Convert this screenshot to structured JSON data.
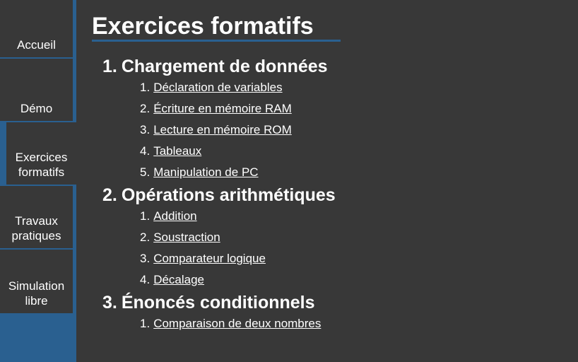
{
  "nav": {
    "items": [
      {
        "label": "Accueil"
      },
      {
        "label": "Démo"
      },
      {
        "label": "Exercices formatifs"
      },
      {
        "label": "Travaux pratiques"
      },
      {
        "label": "Simulation libre"
      }
    ]
  },
  "main": {
    "title": "Exercices formatifs",
    "sections": [
      {
        "number": "1.",
        "title": "Chargement de données",
        "items": [
          {
            "number": "1.",
            "label": "Déclaration de variables"
          },
          {
            "number": "2.",
            "label": "Écriture en mémoire RAM"
          },
          {
            "number": "3.",
            "label": "Lecture en mémoire ROM"
          },
          {
            "number": "4.",
            "label": "Tableaux"
          },
          {
            "number": "5.",
            "label": "Manipulation de PC"
          }
        ]
      },
      {
        "number": "2.",
        "title": "Opérations arithmétiques",
        "items": [
          {
            "number": "1.",
            "label": "Addition"
          },
          {
            "number": "2.",
            "label": "Soustraction"
          },
          {
            "number": "3.",
            "label": "Comparateur logique"
          },
          {
            "number": "4.",
            "label": "Décalage"
          }
        ]
      },
      {
        "number": "3.",
        "title": "Énoncés conditionnels",
        "items": [
          {
            "number": "1.",
            "label": "Comparaison de deux nombres"
          }
        ]
      }
    ]
  },
  "colors": {
    "background": "#383838",
    "accent": "#2a6090",
    "text": "#ffffff"
  }
}
